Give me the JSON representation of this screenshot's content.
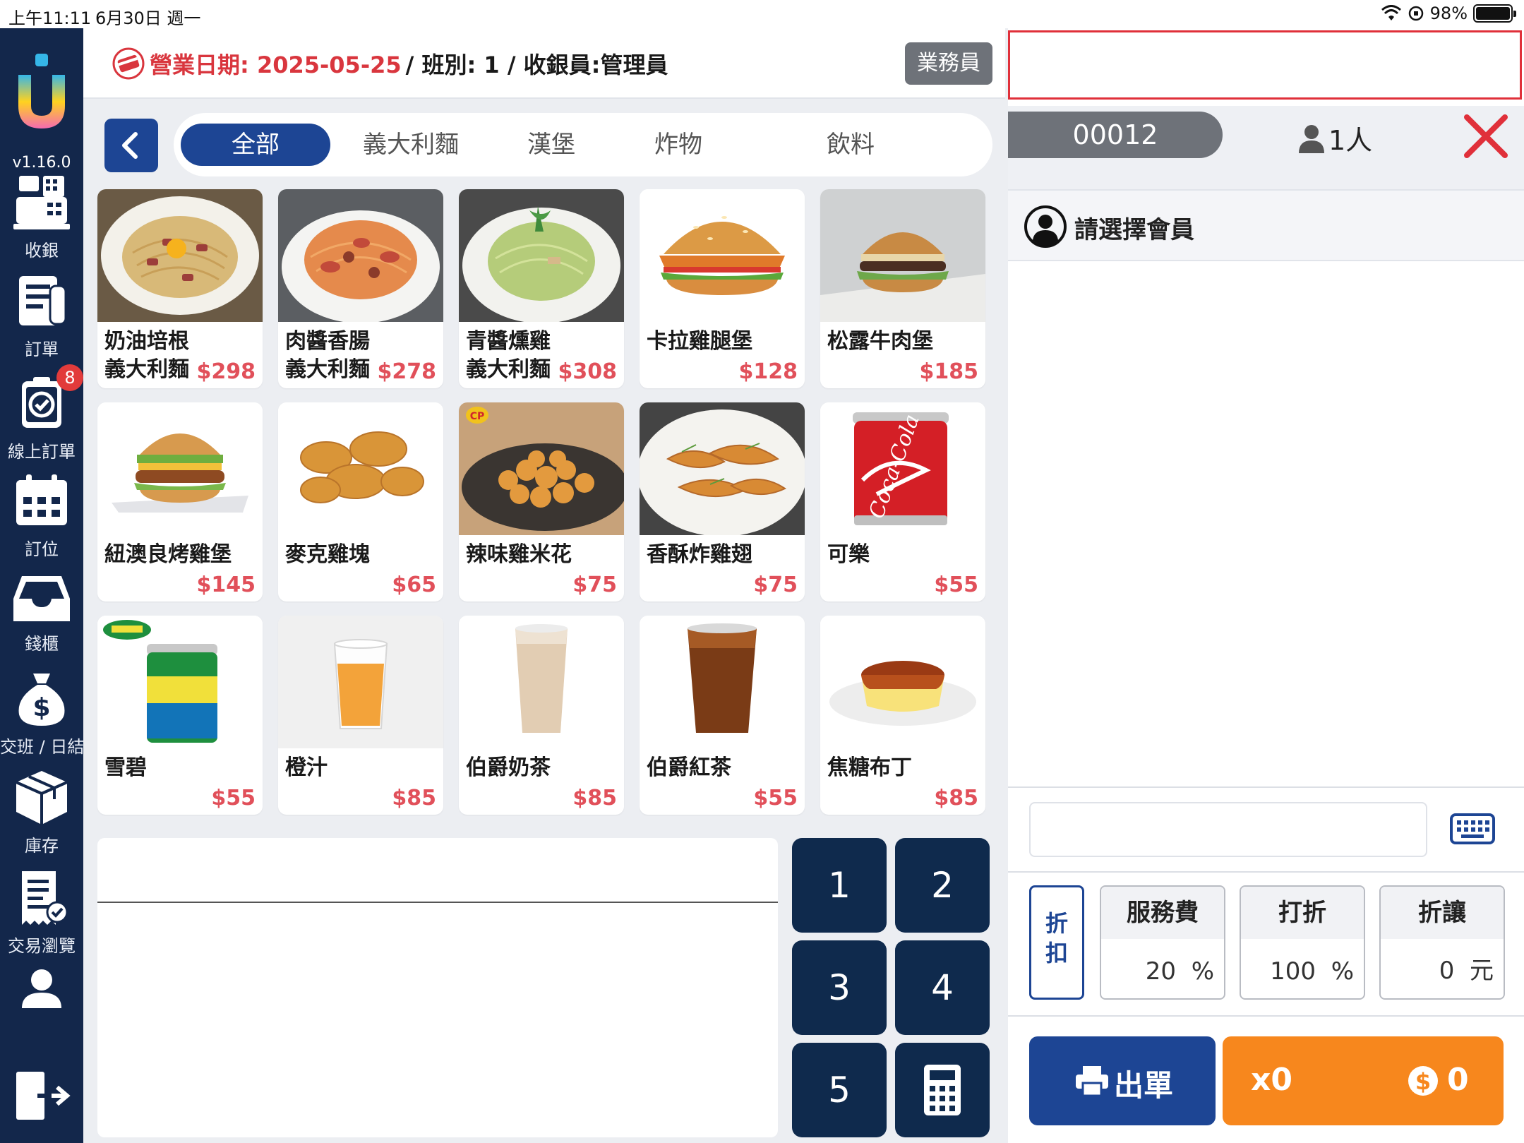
{
  "status_bar": {
    "time": "上午11:11",
    "date": "6月30日 週一",
    "battery": "98%",
    "icons": [
      "wifi-icon",
      "orientation-lock-icon",
      "battery-icon"
    ]
  },
  "sidebar": {
    "version": "v1.16.0",
    "items": [
      {
        "label": "收銀",
        "icon": "cash-register-icon"
      },
      {
        "label": "訂單",
        "icon": "order-icon"
      },
      {
        "label": "線上訂單",
        "icon": "online-order-icon",
        "badge": "8"
      },
      {
        "label": "訂位",
        "icon": "calendar-icon"
      },
      {
        "label": "錢櫃",
        "icon": "drawer-icon"
      },
      {
        "label": "交班 / 日結",
        "icon": "money-bag-icon"
      },
      {
        "label": "庫存",
        "icon": "box-icon"
      },
      {
        "label": "交易瀏覽",
        "icon": "receipt-icon"
      },
      {
        "label": "",
        "icon": "user-icon"
      },
      {
        "label": "",
        "icon": "logout-icon"
      }
    ]
  },
  "header": {
    "business_label": "營業日期: 2025-05-25",
    "shift_info": "/ 班別: 1 / 收銀員:管理員",
    "staff_button": "業務員"
  },
  "categories": {
    "tabs": [
      "全部",
      "義大利麵",
      "漢堡",
      "炸物",
      "飲料"
    ],
    "active": "全部"
  },
  "products": [
    {
      "name": "奶油培根\n義大利麵",
      "price": "$298"
    },
    {
      "name": "肉醬香腸\n義大利麵",
      "price": "$278"
    },
    {
      "name": "青醬燻雞\n義大利麵",
      "price": "$308"
    },
    {
      "name": "卡拉雞腿堡",
      "price": "$128"
    },
    {
      "name": "松露牛肉堡",
      "price": "$185"
    },
    {
      "name": "紐澳良烤雞堡",
      "price": "$145"
    },
    {
      "name": "麥克雞塊",
      "price": "$65"
    },
    {
      "name": "辣味雞米花",
      "price": "$75"
    },
    {
      "name": "香酥炸雞翅",
      "price": "$75"
    },
    {
      "name": "可樂",
      "price": "$55"
    },
    {
      "name": "雪碧",
      "price": "$55"
    },
    {
      "name": "橙汁",
      "price": "$85"
    },
    {
      "name": "伯爵奶茶",
      "price": "$85"
    },
    {
      "name": "伯爵紅茶",
      "price": "$55"
    },
    {
      "name": "焦糖布丁",
      "price": "$85"
    }
  ],
  "keypad": {
    "keys": [
      "1",
      "2",
      "3",
      "4",
      "5"
    ]
  },
  "order": {
    "number": "00012",
    "people": "1人",
    "member_prompt": "請選擇會員",
    "discount_label": "折\n扣",
    "discounts": [
      {
        "title": "服務費",
        "value": "20",
        "unit": "%"
      },
      {
        "title": "打折",
        "value": "100",
        "unit": "%"
      },
      {
        "title": "折讓",
        "value": "0",
        "unit": "元"
      }
    ],
    "print_label": "出單",
    "qty_label": "x0",
    "total_label": "0"
  },
  "colors": {
    "sidebar": "#13274b",
    "accent": "#1d4594",
    "price": "#e1505a",
    "pay": "#f7871d",
    "alert": "#e0303a"
  }
}
